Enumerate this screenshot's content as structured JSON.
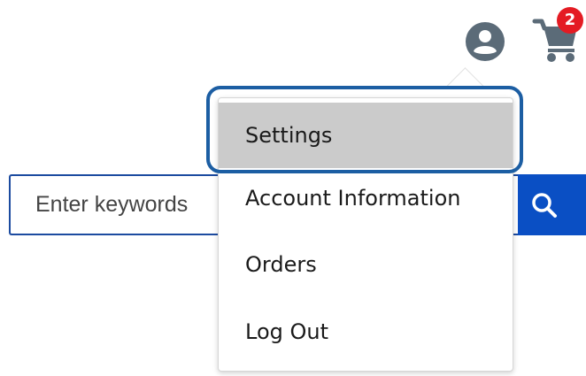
{
  "header": {
    "user_icon": "user-circle-icon",
    "cart_icon": "shopping-cart-icon",
    "cart_count": "2",
    "badge_color": "#e41b23",
    "icon_color": "#5b6b78"
  },
  "search": {
    "placeholder": "Enter keywords",
    "button_icon": "search-icon",
    "button_color": "#0a4fc4",
    "border_color": "#1c4ba0"
  },
  "account_menu": {
    "items": [
      {
        "label": "Settings"
      },
      {
        "label": "Account Information"
      },
      {
        "label": "Orders"
      },
      {
        "label": "Log Out"
      }
    ],
    "highlighted_item": "Settings",
    "highlight_color": "#cbcbcb",
    "focus_ring_color": "#1c5ea3"
  }
}
